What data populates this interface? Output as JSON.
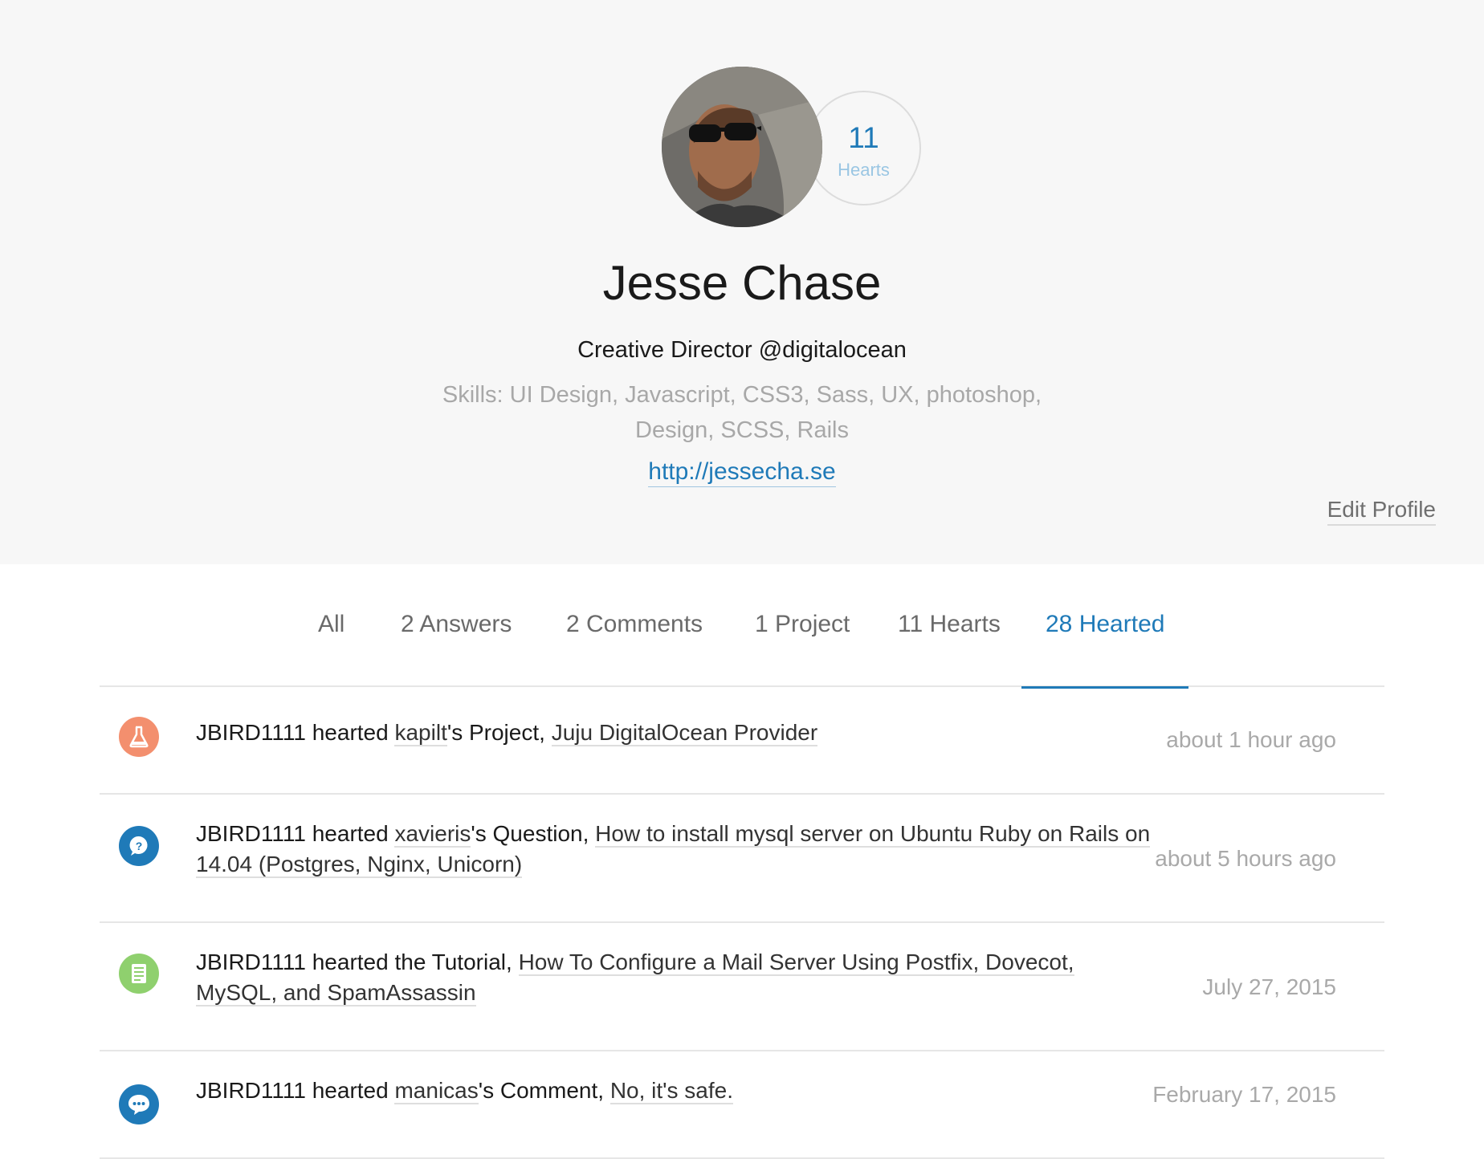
{
  "profile": {
    "name": "Jesse Chase",
    "role": "Creative Director @digitalocean",
    "skills": "Skills: UI Design, Javascript, CSS3, Sass, UX, photoshop, Design, SCSS, Rails",
    "website": "http://jessecha.se",
    "hearts_count": "11",
    "hearts_label": "Hearts",
    "edit_label": "Edit Profile"
  },
  "tabs": [
    {
      "label": "All"
    },
    {
      "label": "2 Answers"
    },
    {
      "label": "2 Comments"
    },
    {
      "label": "1 Project"
    },
    {
      "label": "11 Hearts"
    },
    {
      "label": "28 Hearted",
      "active": true
    }
  ],
  "feed": [
    {
      "icon": "project-icon",
      "color": "#f38f6e",
      "actor_text": "JBIRD1111 hearted ",
      "user": "kapilt",
      "type_text": "'s Project, ",
      "title": "Juju DigitalOcean Provider",
      "time": "about 1 hour ago"
    },
    {
      "icon": "question-icon",
      "color": "#1f7ab8",
      "actor_text": "JBIRD1111 hearted ",
      "user": "xavieris",
      "type_text": "'s Question, ",
      "title": "How to install mysql server on Ubuntu Ruby on Rails on 14.04 (Postgres, Nginx, Unicorn)",
      "time": "about 5 hours ago"
    },
    {
      "icon": "tutorial-icon",
      "color": "#8fd06e",
      "actor_text": "JBIRD1111 hearted the Tutorial, ",
      "title": "How To Configure a Mail Server Using Postfix, Dovecot, MySQL, and SpamAssassin",
      "time": "July 27, 2015"
    },
    {
      "icon": "comment-icon",
      "color": "#1f7ab8",
      "actor_text": "JBIRD1111 hearted ",
      "user": "manicas",
      "type_text": "'s Comment, ",
      "title": "No, it's safe.",
      "time": "February 17, 2015"
    }
  ]
}
